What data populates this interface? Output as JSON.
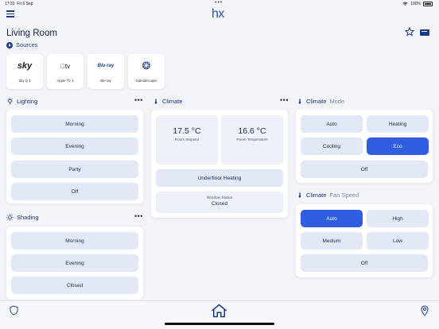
{
  "status_bar": {
    "time": "17:31",
    "date": "Fri 6 Sep",
    "battery": "100%"
  },
  "header": {
    "logo": "hx",
    "room": "Living Room"
  },
  "sources": {
    "title": "Sources",
    "items": [
      {
        "glyph": "sky",
        "label": "Sky Q 1"
      },
      {
        "glyph": "tv",
        "label": "Apple TV 1"
      },
      {
        "glyph": "Blu-ray",
        "label": "Blu-ray"
      },
      {
        "glyph": "❂",
        "label": "Kaleidescape"
      }
    ]
  },
  "lighting": {
    "title": "Lighting",
    "options": [
      "Morning",
      "Evening",
      "Party",
      "Off"
    ]
  },
  "shading": {
    "title": "Shading",
    "options": [
      "Morning",
      "Evening",
      "Closed"
    ]
  },
  "climate": {
    "title": "Climate",
    "setpoint_value": "17.5 °C",
    "setpoint_label": "Room Setpoint",
    "temperature_value": "16.6 °C",
    "temperature_label": "Room Temperature",
    "underfloor_label": "Underfloor Heating",
    "window_label": "Window Status",
    "window_value": "Closed"
  },
  "climate_mode": {
    "title": "Climate",
    "subtitle": "Mode",
    "options": [
      "Auto",
      "Heating",
      "Cooling",
      "Eco",
      "Off"
    ],
    "active": "Eco"
  },
  "climate_fan": {
    "title": "Climate",
    "subtitle": "Fan Speed",
    "options": [
      "Auto",
      "High",
      "Medium",
      "Low",
      "Off"
    ],
    "active": "Auto"
  },
  "colors": {
    "accent": "#2f5fe0",
    "button": "#e3e8f6",
    "text": "#1c2c56"
  }
}
